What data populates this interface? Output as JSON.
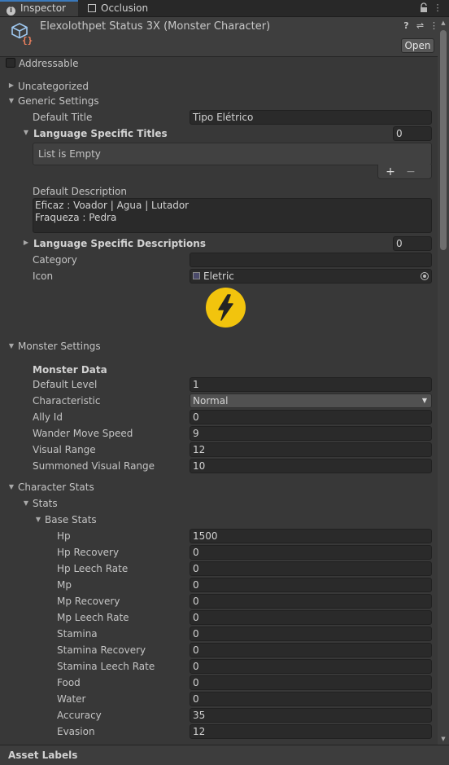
{
  "tabs": [
    {
      "label": "Inspector",
      "icon": "info-icon"
    },
    {
      "label": "Occlusion",
      "icon": "occlusion-icon"
    }
  ],
  "header": {
    "title": "Elexolothpet Status 3X (Monster Character)",
    "open_label": "Open"
  },
  "addressable_label": "Addressable",
  "sections": {
    "uncategorized": "Uncategorized",
    "generic": "Generic Settings",
    "monster": "Monster Settings",
    "character": "Character Stats"
  },
  "generic": {
    "default_title_label": "Default Title",
    "default_title_value": "Tipo Elétrico",
    "lang_titles_label": "Language Specific Titles",
    "lang_titles_count": "0",
    "list_empty": "List is Empty",
    "plus": "+",
    "minus": "−",
    "default_desc_label": "Default Description",
    "default_desc_line1": "Eficaz : Voador | Agua | Lutador",
    "default_desc_line2": "Fraqueza : Pedra",
    "lang_desc_label": "Language Specific Descriptions",
    "lang_desc_count": "0",
    "category_label": "Category",
    "category_value": "",
    "icon_label": "Icon",
    "icon_value": "Eletric"
  },
  "monster": {
    "header": "Monster Data",
    "rows": [
      {
        "label": "Default Level",
        "value": "1"
      },
      {
        "label": "Characteristic",
        "value": "Normal"
      },
      {
        "label": "Ally Id",
        "value": "0"
      },
      {
        "label": "Wander Move Speed",
        "value": "9"
      },
      {
        "label": "Visual Range",
        "value": "12"
      },
      {
        "label": "Summoned Visual Range",
        "value": "10"
      }
    ]
  },
  "stats": {
    "label": "Stats",
    "base_label": "Base Stats",
    "rows": [
      {
        "label": "Hp",
        "value": "1500"
      },
      {
        "label": "Hp Recovery",
        "value": "0"
      },
      {
        "label": "Hp Leech Rate",
        "value": "0"
      },
      {
        "label": "Mp",
        "value": "0"
      },
      {
        "label": "Mp Recovery",
        "value": "0"
      },
      {
        "label": "Mp Leech Rate",
        "value": "0"
      },
      {
        "label": "Stamina",
        "value": "0"
      },
      {
        "label": "Stamina Recovery",
        "value": "0"
      },
      {
        "label": "Stamina Leech Rate",
        "value": "0"
      },
      {
        "label": "Food",
        "value": "0"
      },
      {
        "label": "Water",
        "value": "0"
      },
      {
        "label": "Accuracy",
        "value": "35"
      },
      {
        "label": "Evasion",
        "value": "12"
      }
    ]
  },
  "footer": {
    "label": "Asset Labels"
  },
  "colors": {
    "accent": "#3a79bb",
    "bolt_yellow": "#f2c40d",
    "background": "#383838"
  }
}
